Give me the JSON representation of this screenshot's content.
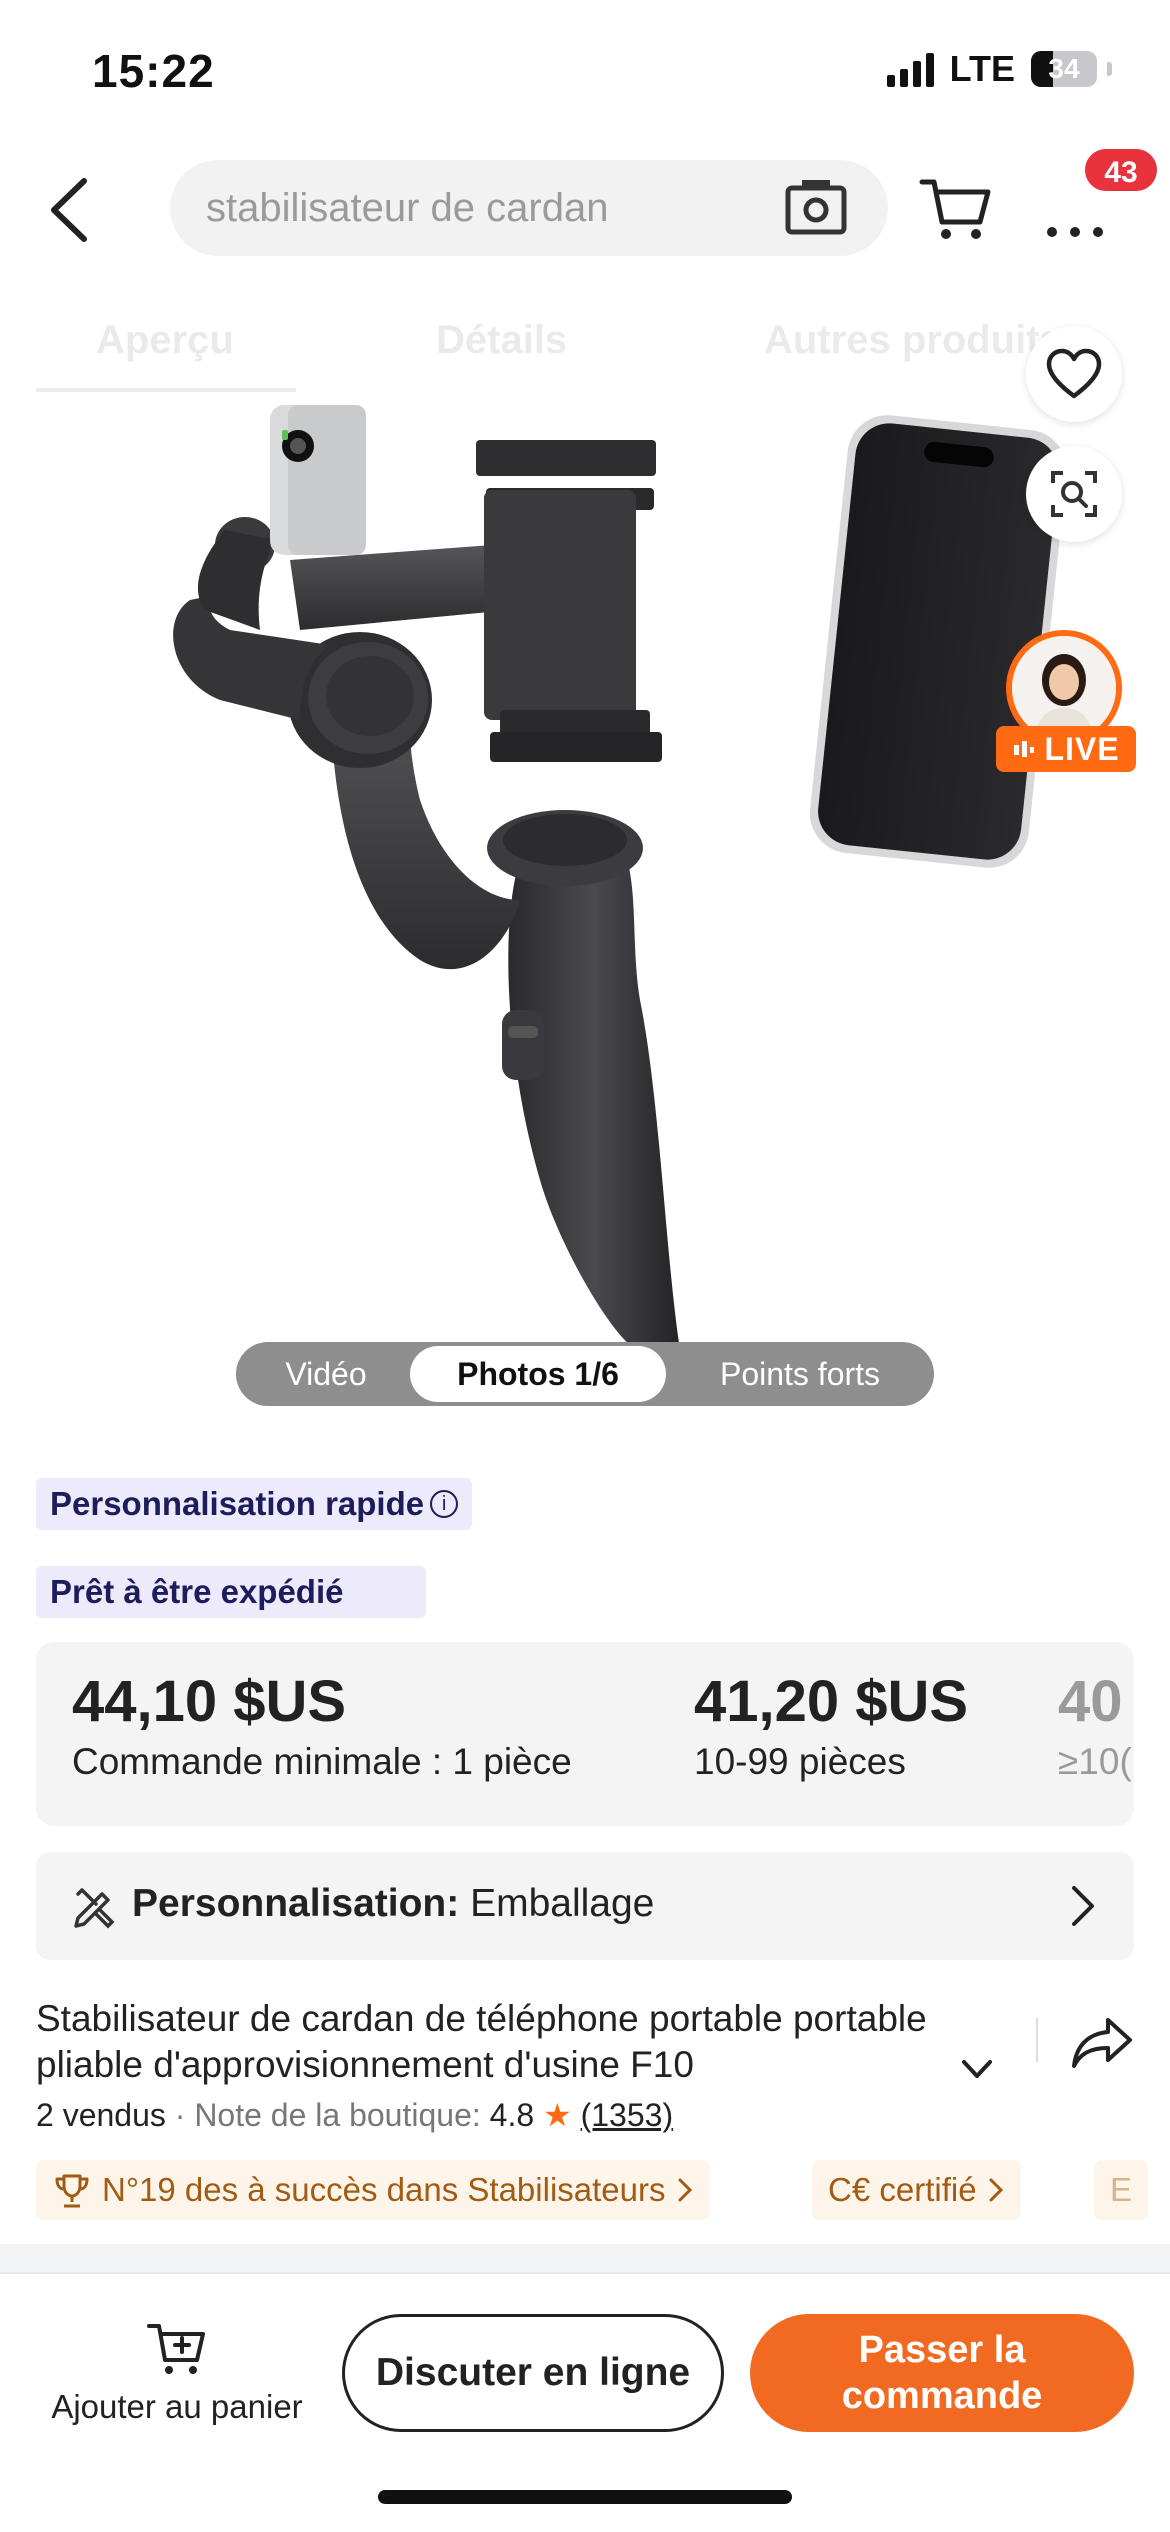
{
  "status_bar": {
    "time": "15:22",
    "network": "LTE",
    "battery_percent": "34",
    "battery_level": 0.34
  },
  "top_nav": {
    "search_placeholder": "stabilisateur de cardan",
    "notification_count": "43",
    "icons": [
      "back-arrow-icon",
      "camera-icon",
      "cart-icon",
      "more-dots-icon"
    ]
  },
  "faded_tabs": [
    "Aperçu",
    "Détails",
    "Autres produits"
  ],
  "media": {
    "items": [
      "Vidéo",
      "Photos 1/6",
      "Points forts"
    ],
    "active_index": 1
  },
  "side_actions": {
    "live_label": "LIVE",
    "icons": [
      "heart-icon",
      "image-search-icon",
      "live-avatar"
    ]
  },
  "tags": {
    "customization": "Personnalisation rapide",
    "ready": "Prêt à être expédié"
  },
  "price_tiers": [
    {
      "price": "44,10 $US",
      "quantity": "Commande minimale : 1 pièce"
    },
    {
      "price": "41,20 $US",
      "quantity": "10-99 pièces"
    },
    {
      "price": "40",
      "quantity": "≥10("
    }
  ],
  "customization": {
    "label": "Personnalisation:",
    "value": "Emballage"
  },
  "product": {
    "title": "Stabilisateur de cardan de téléphone portable portable pliable d'approvisionnement d'usine F10",
    "sold": "2 vendus",
    "rating_label": "Note de la boutique:",
    "rating": "4.8",
    "reviews": "(1353)"
  },
  "chips": [
    {
      "text": "N°19 des à succès dans Stabilisateurs",
      "icon": "trophy-icon"
    },
    {
      "text": "C€ certifié",
      "icon": "ce-mark"
    },
    {
      "text": "E",
      "icon": ""
    }
  ],
  "bottom_bar": {
    "add_to_cart": "Ajouter au panier",
    "chat": "Discuter en ligne",
    "order": "Passer la commande"
  },
  "colors": {
    "accent": "#f26a21",
    "badge": "#e8323c",
    "tag_bg": "#eceafb",
    "tag_text": "#1d1d5c",
    "chip_text": "#a35a12"
  }
}
